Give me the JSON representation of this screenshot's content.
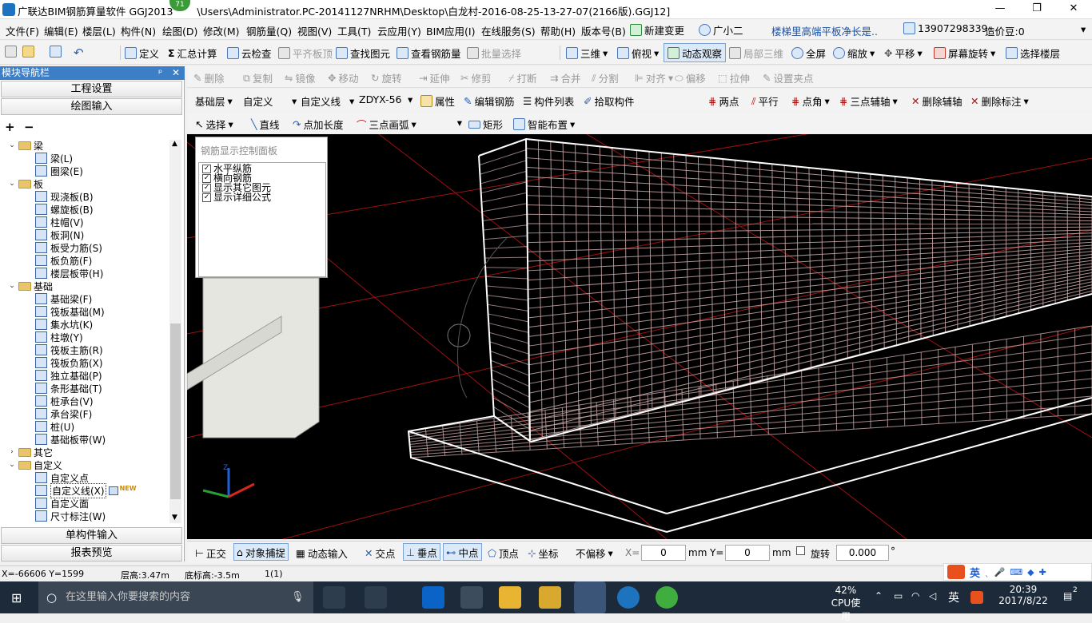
{
  "titlebar": {
    "app_title": "广联达BIM钢筋算量软件 GGJ2013",
    "badge": "71",
    "path": "\\Users\\Administrator.PC-20141127NRHM\\Desktop\\白龙村-2016-08-25-13-27-07(2166版).GGJ12]",
    "minimize": "—",
    "maximize": "❐",
    "close": "✕"
  },
  "menubar": {
    "items": [
      "文件(F)",
      "编辑(E)",
      "楼层(L)",
      "构件(N)",
      "绘图(D)",
      "修改(M)",
      "钢筋量(Q)",
      "视图(V)",
      "工具(T)",
      "云应用(Y)",
      "BIM应用(I)",
      "在线服务(S)",
      "帮助(H)",
      "版本号(B)"
    ],
    "new_change": "新建变更",
    "guangxiaoer": "广小二",
    "notice": "楼梯里高端平板净长是..",
    "phone": "13907298339",
    "cost_bean": "造价豆:0"
  },
  "toolbar1": {
    "define": "定义",
    "sum": "汇总计算",
    "cloud_check": "云检查",
    "align_top": "平齐板顶",
    "find": "查找图元",
    "view_rebar": "查看钢筋量",
    "batch_select": "批量选择",
    "three_d": "三维",
    "top_view": "俯视",
    "dynamic": "动态观察",
    "local_3d": "局部三维",
    "full_screen": "全屏",
    "zoom": "缩放",
    "pan": "平移",
    "rotate": "屏幕旋转",
    "select_floor": "选择楼层"
  },
  "toolbar2": {
    "delete": "删除",
    "copy": "复制",
    "mirror": "镜像",
    "move": "移动",
    "rotate": "旋转",
    "extend": "延伸",
    "trim": "修剪",
    "break": "打断",
    "merge": "合并",
    "split": "分割",
    "align": "对齐",
    "offset": "偏移",
    "stretch": "拉伸",
    "set_grip": "设置夹点"
  },
  "toolbar3": {
    "floor": "基础层",
    "category": "自定义",
    "type": "自定义线",
    "name": "ZDYX-56",
    "prop": "属性",
    "edit_rebar": "编辑钢筋",
    "comp_list": "构件列表",
    "pick": "拾取构件",
    "two_point": "两点",
    "parallel": "平行",
    "point_angle": "点角",
    "three_axis": "三点辅轴",
    "del_axis": "删除辅轴",
    "del_mark": "删除标注"
  },
  "toolbar4": {
    "select": "选择",
    "line": "直线",
    "point_len": "点加长度",
    "arc": "三点画弧",
    "rect": "矩形",
    "smart": "智能布置"
  },
  "left": {
    "header": "模块导航栏",
    "pin": "ᵖ",
    "close": "✕",
    "project_settings": "工程设置",
    "draw_input": "绘图输入",
    "add": "+",
    "remove": "−",
    "single_input": "单构件输入",
    "report": "报表预览",
    "tree": [
      {
        "type": "folder",
        "label": "梁",
        "open": true
      },
      {
        "type": "item",
        "label": "梁(L)"
      },
      {
        "type": "item",
        "label": "圈梁(E)"
      },
      {
        "type": "folder",
        "label": "板",
        "open": true
      },
      {
        "type": "item",
        "label": "现浇板(B)"
      },
      {
        "type": "item",
        "label": "螺旋板(B)"
      },
      {
        "type": "item",
        "label": "柱帽(V)"
      },
      {
        "type": "item",
        "label": "板洞(N)"
      },
      {
        "type": "item",
        "label": "板受力筋(S)"
      },
      {
        "type": "item",
        "label": "板负筋(F)"
      },
      {
        "type": "item",
        "label": "楼层板带(H)"
      },
      {
        "type": "folder",
        "label": "基础",
        "open": true
      },
      {
        "type": "item",
        "label": "基础梁(F)"
      },
      {
        "type": "item",
        "label": "筏板基础(M)"
      },
      {
        "type": "item",
        "label": "集水坑(K)"
      },
      {
        "type": "item",
        "label": "柱墩(Y)"
      },
      {
        "type": "item",
        "label": "筏板主筋(R)"
      },
      {
        "type": "item",
        "label": "筏板负筋(X)"
      },
      {
        "type": "item",
        "label": "独立基础(P)"
      },
      {
        "type": "item",
        "label": "条形基础(T)"
      },
      {
        "type": "item",
        "label": "桩承台(V)"
      },
      {
        "type": "item",
        "label": "承台梁(F)"
      },
      {
        "type": "item",
        "label": "桩(U)"
      },
      {
        "type": "item",
        "label": "基础板带(W)"
      },
      {
        "type": "folder",
        "label": "其它",
        "open": false
      },
      {
        "type": "folder",
        "label": "自定义",
        "open": true
      },
      {
        "type": "item",
        "label": "自定义点"
      },
      {
        "type": "item",
        "label": "自定义线(X)",
        "selected": true,
        "new": "NEW"
      },
      {
        "type": "item",
        "label": "自定义面"
      },
      {
        "type": "item",
        "label": "尺寸标注(W)"
      }
    ]
  },
  "panel": {
    "title": "钢筋显示控制面板",
    "checks": [
      "水平纵筋",
      "横向钢筋",
      "显示其它图元",
      "显示详细公式"
    ]
  },
  "statusbar": {
    "ortho": "正交",
    "snap": "对象捕捉",
    "dyn_input": "动态输入",
    "intersect": "交点",
    "perp": "垂点",
    "mid": "中点",
    "vertex": "顶点",
    "coord": "坐标",
    "offset_mode": "不偏移",
    "x_label": "X=",
    "x_val": "0",
    "y_label": "Y=",
    "y_val": "0",
    "unit": "mm",
    "rotate_label": "旋转",
    "rotate_val": "0.000",
    "deg": "°"
  },
  "coordbar": {
    "xy": "X=-66606 Y=1599",
    "floor_height": "层高:3.47m",
    "bottom_height": "底标高:-3.5m",
    "count": "1(1)"
  },
  "taskbar": {
    "search": "在这里输入你要搜索的内容",
    "cpu_pct": "42%",
    "cpu_label": "CPU使用",
    "ime": "英",
    "time": "20:39",
    "date": "2017/8/22",
    "notif": "2"
  },
  "sogou": {
    "label": "英"
  },
  "colors": {
    "title_bar": "#ffffff",
    "nav_header": "#3c7fc6",
    "viewport": "#000000",
    "rebar": "#c9a8a8",
    "grid": "#b01010",
    "taskbar": "#1c2a3a"
  }
}
